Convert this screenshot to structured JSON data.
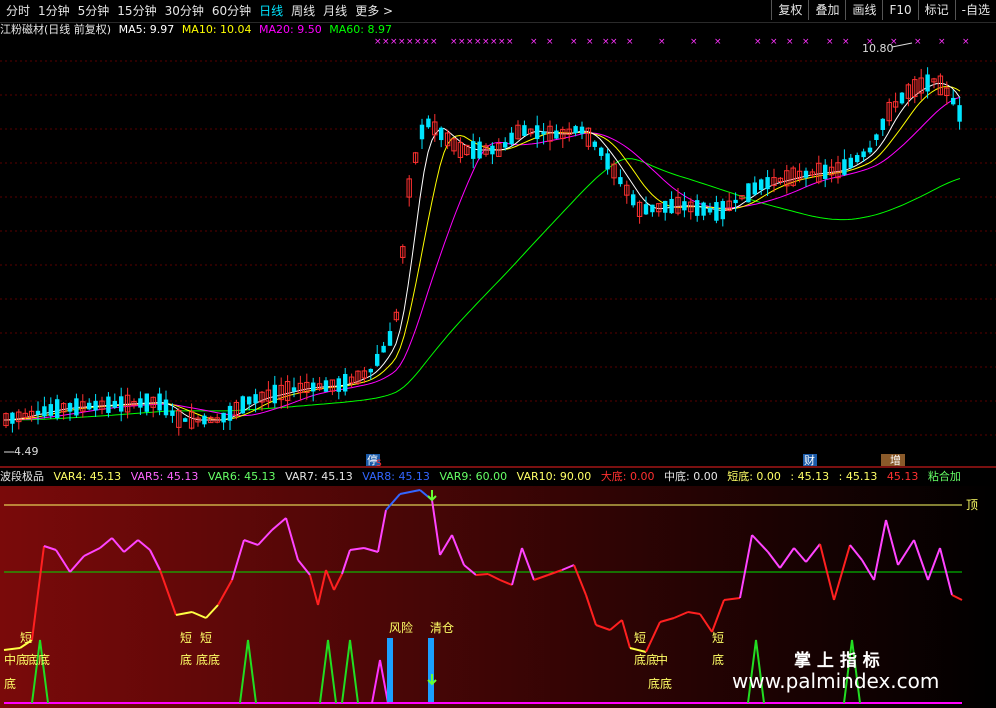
{
  "toolbar": {
    "tabs": [
      "分时",
      "1分钟",
      "5分钟",
      "15分钟",
      "30分钟",
      "60分钟",
      "日线",
      "周线",
      "月线",
      "更多 >"
    ],
    "active_tab": "日线",
    "right_buttons": [
      "复权",
      "叠加",
      "画线",
      "F10",
      "标记",
      "-自选"
    ]
  },
  "main_legend": {
    "stock": "江粉磁材(日线 前复权)",
    "ma5": "MA5: 9.97",
    "ma10": "MA10: 10.04",
    "ma20": "MA20: 9.50",
    "ma60": "MA60: 8.97"
  },
  "main_labels": {
    "high": "10.80",
    "low": "4.49",
    "tag_stop": "停",
    "tag_s": "S",
    "tag_cai": "财",
    "tag_zeng": "增"
  },
  "indicator_legend": {
    "name": "波段极品",
    "var4": "VAR4: 45.13",
    "var5": "VAR5: 45.13",
    "var6": "VAR6: 45.13",
    "var7": "VAR7: 45.13",
    "var8": "VAR8: 45.13",
    "var9": "VAR9: 60.00",
    "var10": "VAR10: 90.00",
    "dadi": "大底: 0.00",
    "zhongdi": "中底: 0.00",
    "duandi": "短底: 0.00",
    "v1": ": 45.13",
    "v2": ": 45.13",
    "v3": "45.13",
    "glue": "粘合加"
  },
  "indicator_labels": {
    "top": "顶",
    "risk": "风险",
    "clear": "清仓",
    "duan": "短",
    "di": "底",
    "zhong": "中",
    "zhongdi": "中底",
    "didi": "底底"
  },
  "watermark": {
    "line1": "掌 上 指 标",
    "line2": "www.palmindex.com"
  },
  "colors": {
    "up": "#ff3030",
    "down": "#00e5ff",
    "ma5": "#ffffff",
    "ma10": "#ffff00",
    "ma20": "#ff00ff",
    "ma60": "#00ff00"
  }
}
